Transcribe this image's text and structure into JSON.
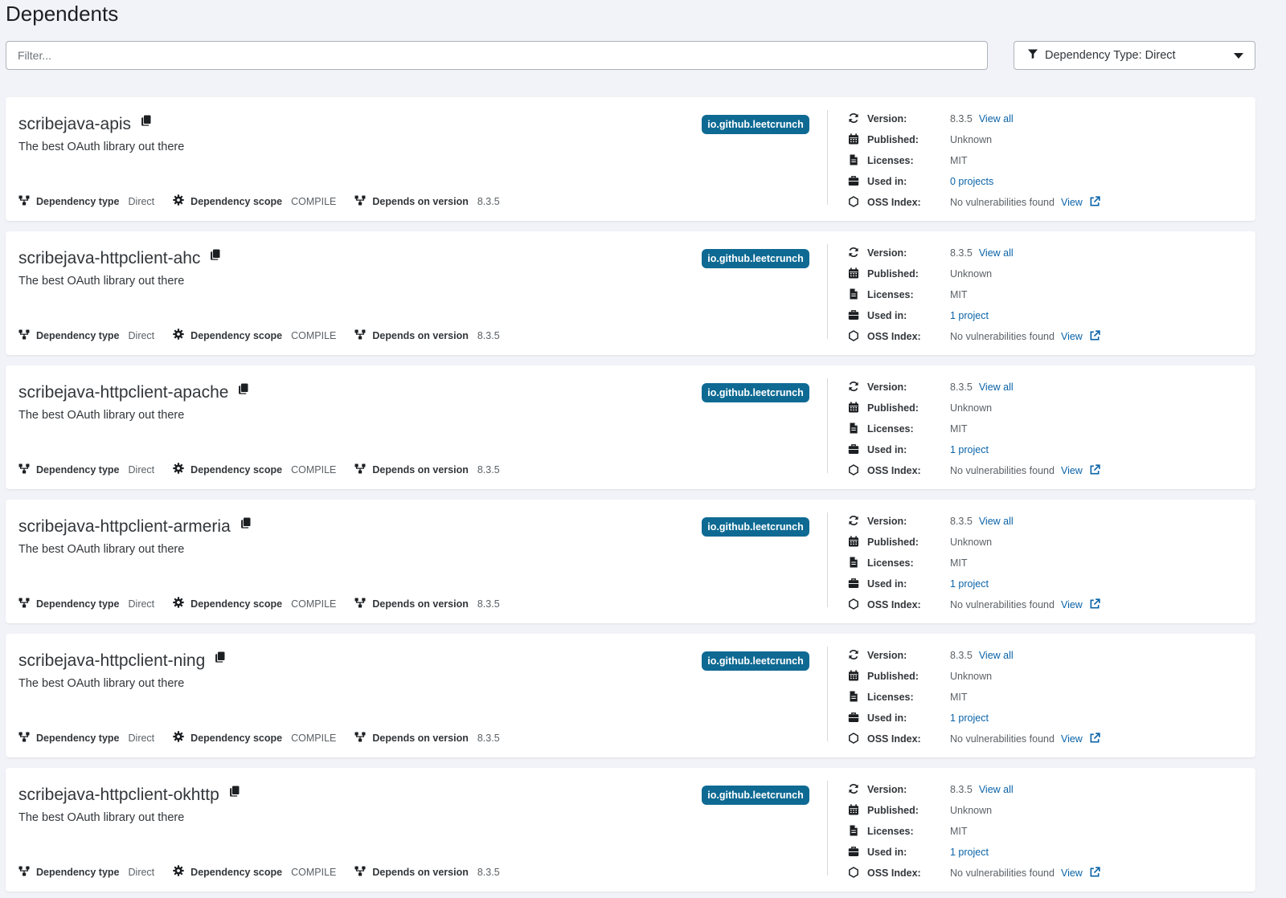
{
  "page": {
    "title": "Dependents"
  },
  "filter": {
    "placeholder": "Filter..."
  },
  "dependency_type_dropdown": {
    "label": "Dependency Type: Direct"
  },
  "labels": {
    "dependency_type": "Dependency type",
    "dependency_scope": "Dependency scope",
    "depends_on_version": "Depends on version",
    "version": "Version:",
    "published": "Published:",
    "licenses": "Licenses:",
    "used_in": "Used in:",
    "oss_index": "OSS Index:",
    "view_all": "View all",
    "view": "View"
  },
  "dependents": [
    {
      "name": "scribejava-apis",
      "description": "The best OAuth library out there",
      "group": "io.github.leetcrunch",
      "dependency_type": "Direct",
      "dependency_scope": "COMPILE",
      "depends_on_version": "8.3.5",
      "version": "8.3.5",
      "published": "Unknown",
      "licenses": "MIT",
      "used_in": "0 projects",
      "oss_index": "No vulnerabilities found"
    },
    {
      "name": "scribejava-httpclient-ahc",
      "description": "The best OAuth library out there",
      "group": "io.github.leetcrunch",
      "dependency_type": "Direct",
      "dependency_scope": "COMPILE",
      "depends_on_version": "8.3.5",
      "version": "8.3.5",
      "published": "Unknown",
      "licenses": "MIT",
      "used_in": "1 project",
      "oss_index": "No vulnerabilities found"
    },
    {
      "name": "scribejava-httpclient-apache",
      "description": "The best OAuth library out there",
      "group": "io.github.leetcrunch",
      "dependency_type": "Direct",
      "dependency_scope": "COMPILE",
      "depends_on_version": "8.3.5",
      "version": "8.3.5",
      "published": "Unknown",
      "licenses": "MIT",
      "used_in": "1 project",
      "oss_index": "No vulnerabilities found"
    },
    {
      "name": "scribejava-httpclient-armeria",
      "description": "The best OAuth library out there",
      "group": "io.github.leetcrunch",
      "dependency_type": "Direct",
      "dependency_scope": "COMPILE",
      "depends_on_version": "8.3.5",
      "version": "8.3.5",
      "published": "Unknown",
      "licenses": "MIT",
      "used_in": "1 project",
      "oss_index": "No vulnerabilities found"
    },
    {
      "name": "scribejava-httpclient-ning",
      "description": "The best OAuth library out there",
      "group": "io.github.leetcrunch",
      "dependency_type": "Direct",
      "dependency_scope": "COMPILE",
      "depends_on_version": "8.3.5",
      "version": "8.3.5",
      "published": "Unknown",
      "licenses": "MIT",
      "used_in": "1 project",
      "oss_index": "No vulnerabilities found"
    },
    {
      "name": "scribejava-httpclient-okhttp",
      "description": "The best OAuth library out there",
      "group": "io.github.leetcrunch",
      "dependency_type": "Direct",
      "dependency_scope": "COMPILE",
      "depends_on_version": "8.3.5",
      "version": "8.3.5",
      "published": "Unknown",
      "licenses": "MIT",
      "used_in": "1 project",
      "oss_index": "No vulnerabilities found"
    }
  ],
  "icons": {
    "filter": "filter-icon",
    "caret": "caret-down-icon",
    "copy": "copy-icon",
    "dependency_type": "hierarchy-icon",
    "dependency_scope": "gear-icon",
    "depends_on_version": "hierarchy-icon",
    "version": "refresh-icon",
    "published": "calendar-icon",
    "licenses": "document-icon",
    "used_in": "briefcase-icon",
    "oss_index": "hexagon-icon",
    "external": "external-link-icon"
  },
  "colors": {
    "badge": "#0e6a93",
    "link": "#0a63a8",
    "background": "#f2f3f8"
  }
}
